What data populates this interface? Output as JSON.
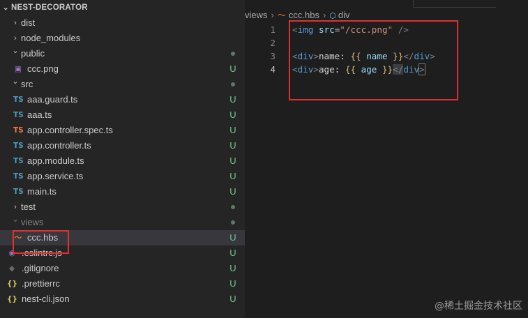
{
  "explorer": {
    "title": "NEST-DECORATOR",
    "items": [
      {
        "label": "dist",
        "kind": "folder",
        "state": "collapsed",
        "depth": 0
      },
      {
        "label": "node_modules",
        "kind": "folder",
        "state": "collapsed",
        "depth": 0
      },
      {
        "label": "public",
        "kind": "folder",
        "state": "expanded",
        "depth": 0,
        "decoration": "dot"
      },
      {
        "label": "ccc.png",
        "kind": "file",
        "icon": "image-file-icon",
        "depth": 1,
        "badge": "U"
      },
      {
        "label": "src",
        "kind": "folder",
        "state": "expanded",
        "depth": 0,
        "decoration": "dot"
      },
      {
        "label": "aaa.guard.ts",
        "kind": "file",
        "icon": "ts-icon",
        "icon_text": "TS",
        "depth": 1,
        "badge": "U"
      },
      {
        "label": "aaa.ts",
        "kind": "file",
        "icon": "ts-icon",
        "icon_text": "TS",
        "depth": 1,
        "badge": "U"
      },
      {
        "label": "app.controller.spec.ts",
        "kind": "file",
        "icon": "ts-spec-icon",
        "icon_text": "TS",
        "depth": 1,
        "badge": "U"
      },
      {
        "label": "app.controller.ts",
        "kind": "file",
        "icon": "ts-icon",
        "icon_text": "TS",
        "depth": 1,
        "badge": "U"
      },
      {
        "label": "app.module.ts",
        "kind": "file",
        "icon": "ts-icon",
        "icon_text": "TS",
        "depth": 1,
        "badge": "U"
      },
      {
        "label": "app.service.ts",
        "kind": "file",
        "icon": "ts-icon",
        "icon_text": "TS",
        "depth": 1,
        "badge": "U"
      },
      {
        "label": "main.ts",
        "kind": "file",
        "icon": "ts-icon",
        "icon_text": "TS",
        "depth": 1,
        "badge": "U"
      },
      {
        "label": "test",
        "kind": "folder",
        "state": "collapsed",
        "depth": 0,
        "decoration": "dot"
      },
      {
        "label": "views",
        "kind": "folder",
        "state": "expanded",
        "depth": 0,
        "decoration": "dot"
      },
      {
        "label": "ccc.hbs",
        "kind": "file",
        "icon": "handlebars-icon",
        "depth": 1,
        "badge": "U",
        "selected": true
      },
      {
        "label": ".eslintrc.js",
        "kind": "file",
        "icon": "eslint-icon",
        "depth": 0,
        "badge": "U"
      },
      {
        "label": ".gitignore",
        "kind": "file",
        "icon": "git-icon",
        "depth": 0,
        "badge": "U"
      },
      {
        "label": ".prettierrc",
        "kind": "file",
        "icon": "json-braces-icon",
        "icon_text": "{}",
        "depth": 0,
        "badge": "U"
      },
      {
        "label": "nest-cli.json",
        "kind": "file",
        "icon": "json-braces-icon",
        "icon_text": "{}",
        "depth": 0,
        "badge": "U"
      }
    ]
  },
  "breadcrumb": {
    "folder": "views",
    "file": "ccc.hbs",
    "symbol": "div"
  },
  "editor": {
    "active_line": 4,
    "lines": [
      {
        "number": "1",
        "text": "<img src=\"/ccc.png\" />"
      },
      {
        "number": "2",
        "text": ""
      },
      {
        "number": "3",
        "text": "<div>name: {{ name }}</div>"
      },
      {
        "number": "4",
        "text": "<div>age: {{ age }}</div>"
      }
    ]
  },
  "icons": {
    "folder_collapsed": "chevron-right-icon",
    "folder_expanded": "chevron-down-icon",
    "symbol": "cube-icon"
  },
  "colors": {
    "untracked_badge": "#73c991",
    "annotation_box": "#e03131",
    "typescript": "#519aba",
    "handlebars": "#f0772b"
  },
  "watermark": "@稀土掘金技术社区"
}
